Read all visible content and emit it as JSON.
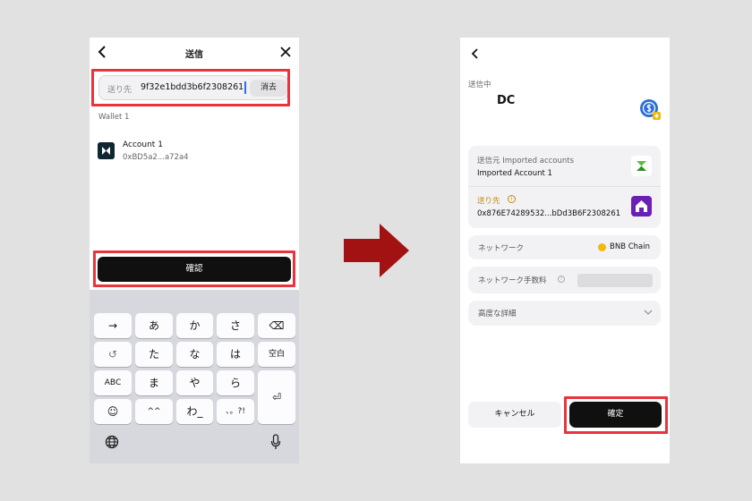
{
  "left": {
    "header_title": "送信",
    "recipient": {
      "label": "送り先",
      "value": "9f32e1bdd3b6f2308261",
      "clear_label": "消去"
    },
    "wallet_section": "Wallet 1",
    "account": {
      "name": "Account 1",
      "address": "0xBD5a2...a72a4"
    },
    "confirm_label": "確認",
    "keyboard": {
      "row1": [
        "→",
        "あ",
        "か",
        "さ",
        "⌫"
      ],
      "row2": [
        "↺",
        "た",
        "な",
        "は",
        "空白"
      ],
      "row3": [
        "ABC",
        "ま",
        "や",
        "ら",
        "⏎"
      ],
      "row4": [
        "☺",
        "^^",
        "わ_",
        "、。?!"
      ]
    }
  },
  "right": {
    "status": "送信中",
    "token": "DC",
    "from_label": "送信元 Imported accounts",
    "from_name": "Imported Account 1",
    "to_label": "送り先",
    "to_address": "0x876E74289532...bDd3B6F2308261",
    "network_label": "ネットワーク",
    "network_value": "BNB Chain",
    "fee_label": "ネットワーク手数料",
    "advanced_label": "高度な詳細",
    "cancel_label": "キャンセル",
    "confirm_label": "確定"
  },
  "colors": {
    "highlight": "#e8343a",
    "arrow": "#a31212",
    "button": "#101010"
  }
}
